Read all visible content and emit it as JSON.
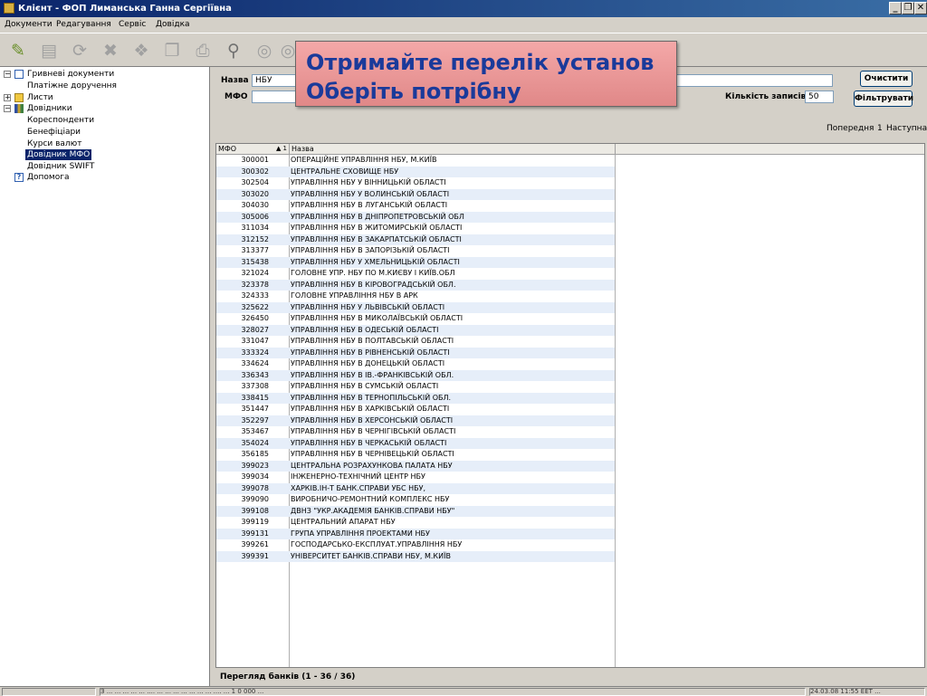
{
  "window": {
    "title": "Клієнт - ФОП Лиманська Ганна Сергіївна",
    "controls": {
      "minimize": "_",
      "maximize": "❐",
      "close": "✕"
    }
  },
  "menu": [
    "Документи",
    "Редагування",
    "Сервіс",
    "Довідка"
  ],
  "toolbar": {
    "icons": [
      "edit-icon",
      "document-icon",
      "refresh-icon",
      "delete-icon",
      "stamp-icon",
      "copy-icon",
      "print-icon",
      "search-icon",
      "disk-icon",
      "disk-icon"
    ]
  },
  "tree": [
    {
      "label": "Гривневі документи",
      "level": 0,
      "toggle": "−",
      "icon": "document"
    },
    {
      "label": "Платіжне доручення",
      "level": 1
    },
    {
      "label": "Листи",
      "level": 0,
      "toggle": "+",
      "icon": "envelope"
    },
    {
      "label": "Довідники",
      "level": 0,
      "toggle": "−",
      "icon": "books"
    },
    {
      "label": "Кореспонденти",
      "level": 1
    },
    {
      "label": "Бенефіціари",
      "level": 1
    },
    {
      "label": "Курси валют",
      "level": 1
    },
    {
      "label": "Довідник МФО",
      "level": 1,
      "selected": true
    },
    {
      "label": "Довідник SWIFT",
      "level": 1
    },
    {
      "label": "Допомога",
      "level": 0,
      "icon": "help"
    }
  ],
  "filter": {
    "name_label": "Назва",
    "name_value": "НБУ",
    "mfo_label": "МФО",
    "mfo_value": "",
    "count_label": "Кількість записів",
    "count_value": "50",
    "clear_button": "Очистити",
    "filter_button": "Фільтрувати"
  },
  "callout": {
    "line1": "Отримайте перелік установ",
    "line2": "Оберіть потрібну"
  },
  "pager": {
    "prev": "Попередня",
    "page": "1",
    "next": "Наступна"
  },
  "grid": {
    "columns": [
      "МФО",
      "Назва"
    ],
    "sort_indicator": "▲ 1",
    "rows": [
      [
        "300001",
        "ОПЕРАЦІЙНЕ УПРАВЛІННЯ НБУ, М.КИЇВ"
      ],
      [
        "300302",
        "ЦЕНТРАЛЬНЕ СХОВИЩЕ НБУ"
      ],
      [
        "302504",
        "УПРАВЛІННЯ НБУ У ВІННИЦЬКІЙ ОБЛАСТІ"
      ],
      [
        "303020",
        "УПРАВЛІННЯ НБУ У ВОЛИНСЬКІЙ ОБЛАСТІ"
      ],
      [
        "304030",
        "УПРАВЛІННЯ НБУ В ЛУГАНСЬКІЙ ОБЛАСТІ"
      ],
      [
        "305006",
        "УПРАВЛІННЯ НБУ В ДНІПРОПЕТРОВСЬКІЙ ОБЛ"
      ],
      [
        "311034",
        "УПРАВЛІННЯ НБУ В ЖИТОМИРСЬКІЙ ОБЛАСТІ"
      ],
      [
        "312152",
        "УПРАВЛІННЯ НБУ В ЗАКАРПАТСЬКІЙ ОБЛАСТІ"
      ],
      [
        "313377",
        "УПРАВЛІННЯ НБУ В ЗАПОРІЗЬКІЙ ОБЛАСТІ"
      ],
      [
        "315438",
        "УПРАВЛІННЯ НБУ У ХМЕЛЬНИЦЬКІЙ ОБЛАСТІ"
      ],
      [
        "321024",
        "ГОЛОВНЕ УПР. НБУ ПО М.КИЄВУ І КИЇВ.ОБЛ"
      ],
      [
        "323378",
        "УПРАВЛІННЯ НБУ В КІРОВОГРАДСЬКІЙ ОБЛ."
      ],
      [
        "324333",
        "ГОЛОВНЕ УПРАВЛІННЯ НБУ В АРК"
      ],
      [
        "325622",
        "УПРАВЛІННЯ НБУ У ЛЬВІВСЬКІЙ ОБЛАСТІ"
      ],
      [
        "326450",
        "УПРАВЛІННЯ НБУ В МИКОЛАЇВСЬКІЙ ОБЛАСТІ"
      ],
      [
        "328027",
        "УПРАВЛІННЯ НБУ В ОДЕСЬКІЙ ОБЛАСТІ"
      ],
      [
        "331047",
        "УПРАВЛІННЯ НБУ В ПОЛТАВСЬКІЙ ОБЛАСТІ"
      ],
      [
        "333324",
        "УПРАВЛІННЯ НБУ В РІВНЕНСЬКІЙ  ОБЛАСТІ"
      ],
      [
        "334624",
        "УПРАВЛІННЯ НБУ В ДОНЕЦЬКІЙ ОБЛАСТІ"
      ],
      [
        "336343",
        "УПРАВЛІННЯ НБУ В ІВ.-ФРАНКІВСЬКІЙ ОБЛ."
      ],
      [
        "337308",
        "УПРАВЛІННЯ НБУ В СУМСЬКІЙ ОБЛАСТІ"
      ],
      [
        "338415",
        "УПРАВЛІННЯ НБУ В ТЕРНОПІЛЬСЬКІЙ ОБЛ."
      ],
      [
        "351447",
        "УПРАВЛІННЯ НБУ В ХАРКІВСЬКІЙ ОБЛАСТІ"
      ],
      [
        "352297",
        "УПРАВЛІННЯ НБУ В ХЕРСОНСЬКІЙ ОБЛАСТІ"
      ],
      [
        "353467",
        "УПРАВЛІННЯ НБУ В ЧЕРНІГІВСЬКІЙ ОБЛАСТІ"
      ],
      [
        "354024",
        "УПРАВЛІННЯ НБУ В ЧЕРКАСЬКІЙ ОБЛАСТІ"
      ],
      [
        "356185",
        "УПРАВЛІННЯ НБУ В ЧЕРНІВЕЦЬКІЙ ОБЛАСТІ"
      ],
      [
        "399023",
        "ЦЕНТРАЛЬНА РОЗРАХУНКОВА ПАЛАТА НБУ"
      ],
      [
        "399034",
        "ІНЖЕНЕРНО-ТЕХНІЧНИЙ ЦЕНТР НБУ"
      ],
      [
        "399078",
        "ХАРКІВ.ІН-Т БАНК.СПРАВИ УБС НБУ,"
      ],
      [
        "399090",
        "ВИРОБНИЧО-РЕМОНТНИЙ КОМПЛЕКС НБУ"
      ],
      [
        "399108",
        "ДВНЗ \"УКР.АКАДЕМІЯ БАНКІВ.СПРАВИ НБУ\""
      ],
      [
        "399119",
        "ЦЕНТРАЛЬНИЙ АПАРАТ НБУ"
      ],
      [
        "399131",
        "ГРУПА УПРАВЛІННЯ ПРОЕКТАМИ НБУ"
      ],
      [
        "399261",
        "ГОСПОДАРСЬКО-ЕКСПЛУАТ.УПРАВЛІННЯ НБУ"
      ],
      [
        "399391",
        "УНІВЕРСИТЕТ БАНКІВ.СПРАВИ НБУ, М.КИЇВ"
      ]
    ]
  },
  "footer": {
    "label": "Перегляд банків  (1 - 36 / 36)"
  },
  "status": {
    "left": "",
    "middle": "З ... ... ... ... ... .... ... ... ... ... ... ... ... .... ... 1 0 000 ...",
    "right": "24.03.08 11:55 EET ..."
  },
  "colors": {
    "title_bar": "#0a246a",
    "selection": "#0a246a",
    "callout_text": "#1a3a9a",
    "callout_bg": "#f0a0a0",
    "row_alt": "#e6eef9"
  }
}
